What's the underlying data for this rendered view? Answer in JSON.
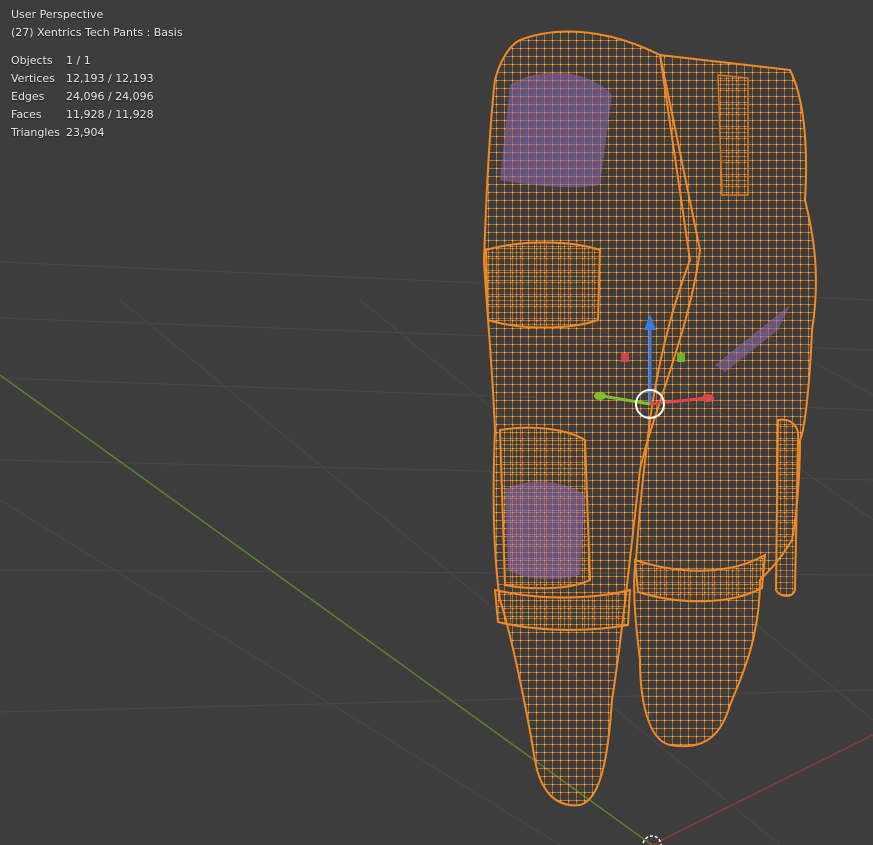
{
  "viewport": {
    "view_name": "User Perspective",
    "object_label": "(27) Xentrics Tech Pants : Basis"
  },
  "stats": [
    {
      "label": "Objects",
      "value": "1 / 1"
    },
    {
      "label": "Vertices",
      "value": "12,193 / 12,193"
    },
    {
      "label": "Edges",
      "value": "24,096 / 24,096"
    },
    {
      "label": "Faces",
      "value": "11,928 / 11,928"
    },
    {
      "label": "Triangles",
      "value": "23,904"
    }
  ],
  "colors": {
    "background": "#3d3d3d",
    "grid": "#474747",
    "x_axis": "#8a3a3a",
    "y_axis": "#5f7f2f",
    "mesh": "#f08a24",
    "texture_patch": "#8a6ab0",
    "gizmo_x": "#e0454a",
    "gizmo_y": "#7ec22a",
    "gizmo_z": "#3a7be0"
  },
  "icons": {
    "object_origin": "circle-origin-icon",
    "transform_gizmo": "transform-gizmo-icon"
  }
}
